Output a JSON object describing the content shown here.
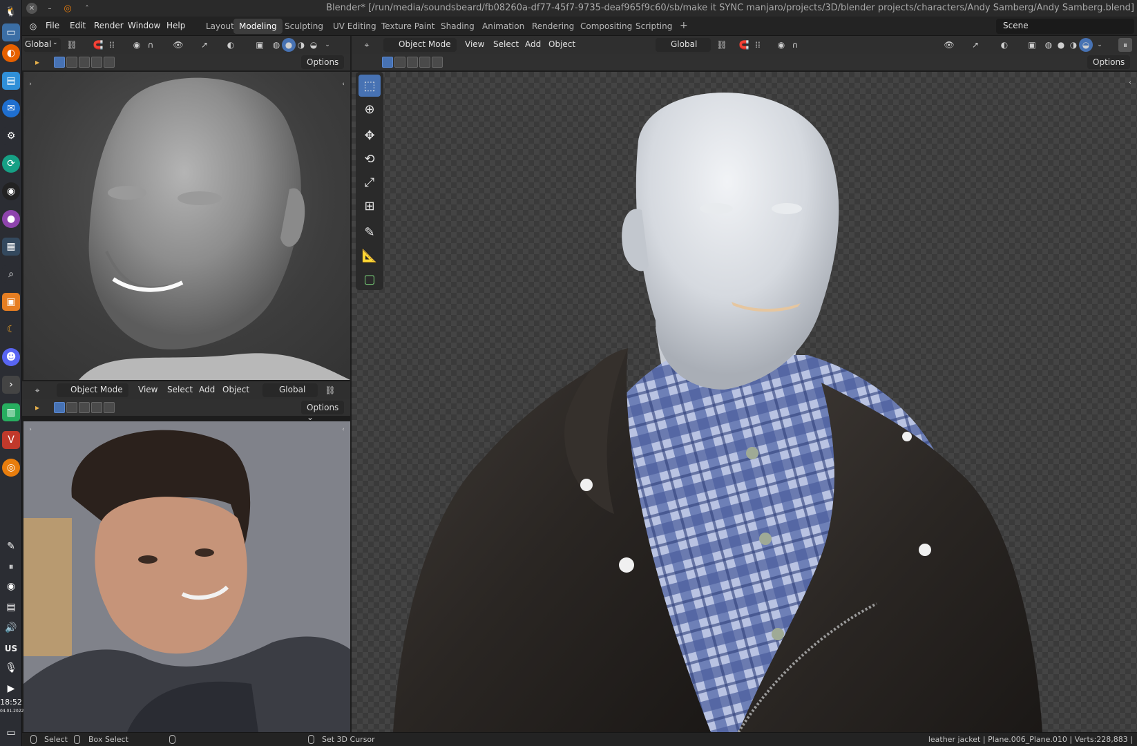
{
  "window": {
    "title": "Blender* [/run/media/soundsbeard/fb08260a-df77-45f7-9735-deaf965f9c60/sb/make it SYNC manjaro/projects/3D/blender projects/characters/Andy Samberg/Andy Samberg.blend]"
  },
  "menu": [
    "File",
    "Edit",
    "Render",
    "Window",
    "Help"
  ],
  "workspaces": [
    "Layout",
    "Modeling",
    "Sculpting",
    "UV Editing",
    "Texture Paint",
    "Shading",
    "Animation",
    "Rendering",
    "Compositing",
    "Scripting"
  ],
  "workspace_add": "+",
  "scene": "Scene",
  "top_left_header": {
    "orientation": "Global",
    "options": "Options"
  },
  "bottom_left_header": {
    "mode": "Object Mode",
    "view": "View",
    "select": "Select",
    "add": "Add",
    "object": "Object",
    "orientation": "Global",
    "options": "Options"
  },
  "main_header": {
    "mode": "Object Mode",
    "view": "View",
    "select": "Select",
    "add": "Add",
    "object": "Object",
    "orientation": "Global",
    "options": "Options"
  },
  "dock": {
    "keyboard_layout": "US",
    "time": "18:52",
    "date": "04.01.2022"
  },
  "status": {
    "select": "Select",
    "box_select": "Box Select",
    "cursor": "Set 3D Cursor",
    "info": "leather jacket | Plane.006_Plane.010 | Verts:228,883 |"
  },
  "colors": {
    "accent": "#4772b3",
    "header": "#2f2f2f",
    "viewport": "#3a3a3a",
    "jacket": "#2e2a27",
    "shirt": "#6a7fb8",
    "skin_render": "#d8dde4"
  }
}
